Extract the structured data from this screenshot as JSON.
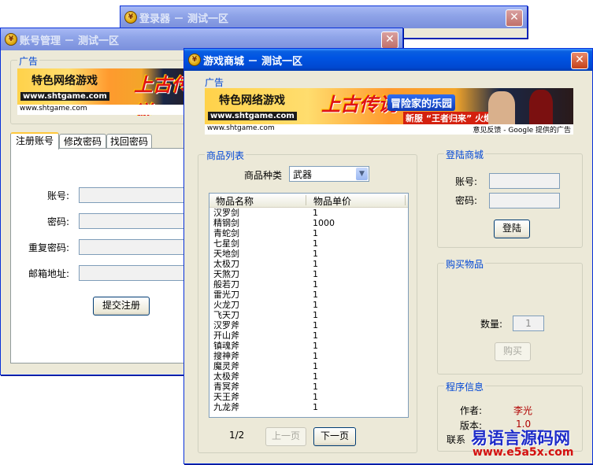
{
  "login_window": {
    "title": "登录器 － 测试一区",
    "close": "✕"
  },
  "account_window": {
    "title": "账号管理 － 测试一区",
    "close": "✕",
    "ad_legend": "广告",
    "ad": {
      "slogan": "特色网络游戏",
      "logo": "上古传说",
      "url": "www.shtgame.com",
      "url_small": "www.shtgame.com"
    },
    "tabs": [
      "注册账号",
      "修改密码",
      "找回密码"
    ],
    "form": {
      "account": "账号:",
      "password": "密码:",
      "repeat_password": "重复密码:",
      "email": "邮箱地址:"
    },
    "submit": "提交注册"
  },
  "shop_window": {
    "title": "游戏商城 － 测试一区",
    "close": "✕",
    "ad_legend": "广告",
    "ad": {
      "slogan": "特色网络游戏",
      "logo": "上古传说",
      "url": "www.shtgame.com",
      "url_small": "www.shtgame.com",
      "tag1": "冒险家的乐园",
      "tag2": "新服 “王者归来” 火爆开启",
      "feedback": "意见反馈 - Google 提供的广告"
    },
    "goods_legend": "商品列表",
    "category_label": "商品种类",
    "category_value": "武器",
    "columns": [
      "物品名称",
      "物品单价"
    ],
    "items": [
      {
        "name": "汉罗剑",
        "price": "1"
      },
      {
        "name": "精钢剑",
        "price": "1000"
      },
      {
        "name": "青蛇剑",
        "price": "1"
      },
      {
        "name": "七星剑",
        "price": "1"
      },
      {
        "name": "天地剑",
        "price": "1"
      },
      {
        "name": "太极刀",
        "price": "1"
      },
      {
        "name": "天煞刀",
        "price": "1"
      },
      {
        "name": "般若刀",
        "price": "1"
      },
      {
        "name": "雷光刀",
        "price": "1"
      },
      {
        "name": "火龙刀",
        "price": "1"
      },
      {
        "name": "飞天刀",
        "price": "1"
      },
      {
        "name": "汉罗斧",
        "price": "1"
      },
      {
        "name": "开山斧",
        "price": "1"
      },
      {
        "name": "镇魂斧",
        "price": "1"
      },
      {
        "name": "搜神斧",
        "price": "1"
      },
      {
        "name": "魔灵斧",
        "price": "1"
      },
      {
        "name": "太极斧",
        "price": "1"
      },
      {
        "name": "青冥斧",
        "price": "1"
      },
      {
        "name": "天王斧",
        "price": "1"
      },
      {
        "name": "九龙斧",
        "price": "1"
      }
    ],
    "page": "1/2",
    "prev": "上一页",
    "next": "下一页",
    "login_legend": "登陆商城",
    "account_label": "账号:",
    "password_label": "密码:",
    "login_button": "登陆",
    "buy_legend": "购买物品",
    "qty_label": "数量:",
    "qty_value": "1",
    "buy_button": "购买",
    "info_legend": "程序信息",
    "author_label": "作者:",
    "author_value": "李光",
    "version_label": "版本:",
    "version_value": "1.0",
    "contact_label": "联系"
  },
  "watermark": {
    "line1": "易语言源码网",
    "line2": "www.e5a5x.com"
  },
  "colors": {
    "title_active": "#0054e3",
    "legend": "#0046d5",
    "author": "#b00000"
  }
}
